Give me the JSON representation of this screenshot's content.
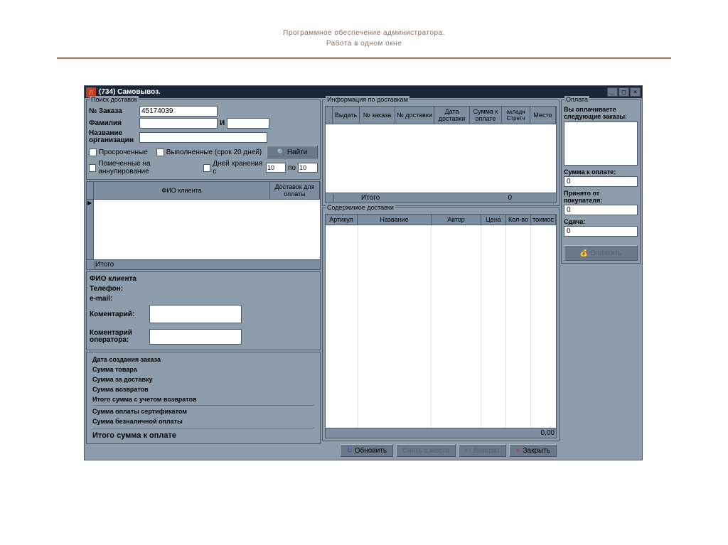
{
  "page_heading": {
    "line1": "Программное обеспечение администратора.",
    "line2": "Работа в одном окне"
  },
  "window": {
    "title": "(734) Самовывоз."
  },
  "search": {
    "group_title": "Поиск доставок",
    "order_label": "№ Заказа",
    "order_value": "45174039",
    "surname_label": "Фамилия",
    "surname_value": "",
    "and_label": "И",
    "org_label": "Название организации",
    "org_value": "",
    "overdue_label": "Просроченные",
    "completed_label": "Выполненные (срок 20 дней)",
    "marked_cancel_label": "Помеченные на аннулирование",
    "storage_days_label": "Дней хранения с",
    "storage_from": "10",
    "storage_to_label": "по",
    "storage_to": "10",
    "find_button": "Найти"
  },
  "clients_grid": {
    "col_fio": "ФИО клиента",
    "col_delivery": "Доставок для оплаты",
    "footer": "Итого"
  },
  "client_details": {
    "fio_label": "ФИО клиента",
    "phone_label": "Телефон:",
    "email_label": "e-mail:",
    "comment_label": "Коментарий:",
    "operator_comment_label": "Коментарий оператора:"
  },
  "summary": {
    "created": "Дата создания заказа",
    "goods_sum": "Сумма товара",
    "delivery_sum": "Сумма за доставку",
    "returns_sum": "Сумма возвратов",
    "with_returns": "Итого сумма с учетом возвратов",
    "cert_pay": "Сумма оплаты сертификатом",
    "cashless_pay": "Сумма безналичной оплаты",
    "total": "Итого сумма к оплате"
  },
  "delivery_info": {
    "group_title": "Информация по доставкам",
    "col_issue": "Выдать",
    "col_order": "№ заказа",
    "col_delivery": "№ доставки",
    "col_date": "Дата доставки",
    "col_sum": "Сумма к оплате",
    "col_invoice": "акладн Стретч",
    "col_place": "Место",
    "footer_label": "Итого",
    "footer_sum": "0"
  },
  "contents": {
    "group_title": "Содержимое доставки",
    "col_article": "Артикул",
    "col_name": "Название",
    "col_author": "Автор",
    "col_price": "Цена",
    "col_qty": "Кол-во",
    "col_cost": "тоимос",
    "footer_sum": "0,00"
  },
  "bottom": {
    "refresh": "Обновить",
    "remove_place": "Снять с места",
    "return": "Возврат",
    "close": "Закрыть"
  },
  "payment": {
    "group_title": "Оплата",
    "you_pay_label": "Вы оплачиваете следующие заказы:",
    "sum_label": "Сумма к оплате:",
    "sum_value": "0",
    "received_label": "Принято от покупателя:",
    "received_value": "0",
    "change_label": "Сдача:",
    "change_value": "0",
    "pay_button": "Оплатить"
  }
}
